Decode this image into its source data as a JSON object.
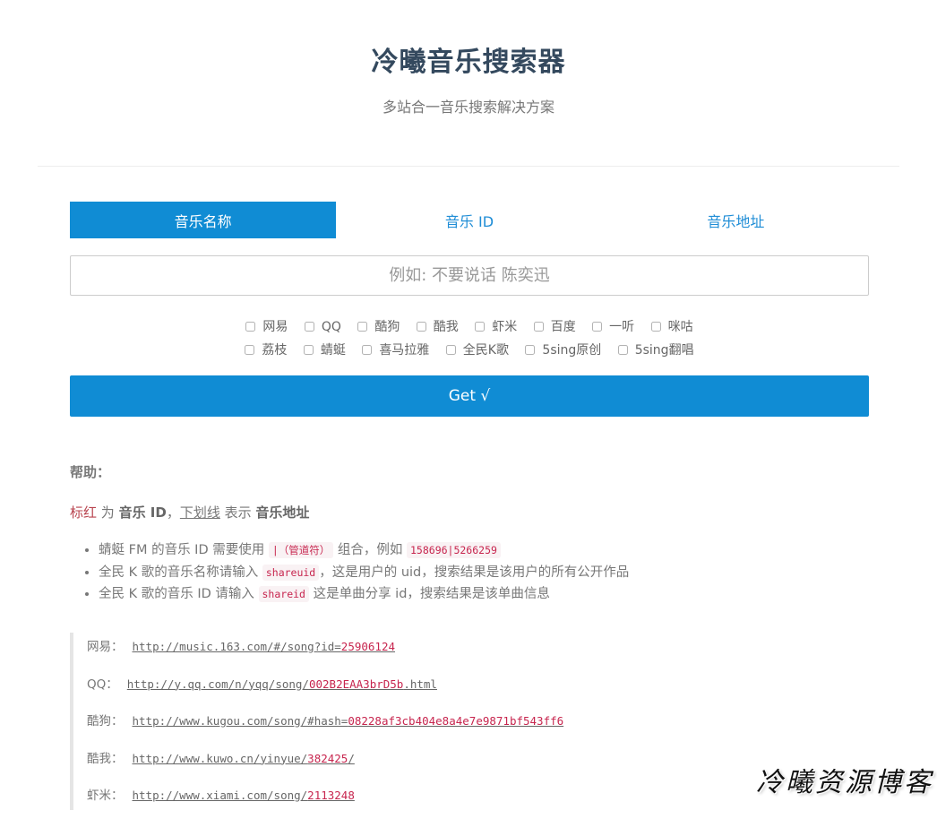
{
  "header": {
    "title": "冷曦音乐搜索器",
    "subtitle": "多站合一音乐搜索解决方案"
  },
  "tabs": [
    {
      "label": "音乐名称",
      "active": true
    },
    {
      "label": "音乐 ID",
      "active": false
    },
    {
      "label": "音乐地址",
      "active": false
    }
  ],
  "search": {
    "placeholder": "例如: 不要说话 陈奕迅",
    "value": ""
  },
  "sites": {
    "row1": [
      "网易",
      "QQ",
      "酷狗",
      "酷我",
      "虾米",
      "百度",
      "一听",
      "咪咕"
    ],
    "row2": [
      "荔枝",
      "蜻蜓",
      "喜马拉雅",
      "全民K歌",
      "5sing原创",
      "5sing翻唱"
    ]
  },
  "get_button": {
    "label": "Get √"
  },
  "help": {
    "title": "帮助：",
    "legend": {
      "red": "标红",
      "t1": " 为 ",
      "bold1": "音乐 ID",
      "t2": "，",
      "underline": "下划线",
      "t3": " 表示 ",
      "bold2": "音乐地址"
    },
    "notes": [
      {
        "pre": "蜻蜓 FM 的音乐 ID 需要使用 ",
        "code1": "|（管道符）",
        "mid": " 组合，例如 ",
        "code2": "158696|5266259",
        "post": ""
      },
      {
        "pre": "全民 K 歌的音乐名称请输入 ",
        "code1": "shareuid",
        "mid": "，这是用户的 uid，搜索结果是该用户的所有公开作品",
        "code2": "",
        "post": ""
      },
      {
        "pre": "全民 K 歌的音乐 ID 请输入 ",
        "code1": "shareid",
        "mid": " 这是单曲分享 id，搜索结果是该单曲信息",
        "code2": "",
        "post": ""
      }
    ]
  },
  "examples": [
    {
      "site": "网易：",
      "url_prefix": "http://music.163.com/#/song?id=",
      "id": "25906124",
      "url_suffix": ""
    },
    {
      "site": "QQ：",
      "url_prefix": "http://y.qq.com/n/yqq/song/",
      "id": "002B2EAA3brD5b",
      "url_suffix": ".html"
    },
    {
      "site": "酷狗：",
      "url_prefix": "http://www.kugou.com/song/#hash=",
      "id": "08228af3cb404e8a4e7e9871bf543ff6",
      "url_suffix": ""
    },
    {
      "site": "酷我：",
      "url_prefix": "http://www.kuwo.cn/yinyue/",
      "id": "382425",
      "url_suffix": "/"
    },
    {
      "site": "虾米：",
      "url_prefix": "http://www.xiami.com/song/",
      "id": "2113248",
      "url_suffix": ""
    }
  ],
  "watermark": "冷曦资源博客",
  "colors": {
    "accent": "#108cd4",
    "title": "#34495e",
    "highlight": "#c7254e"
  }
}
